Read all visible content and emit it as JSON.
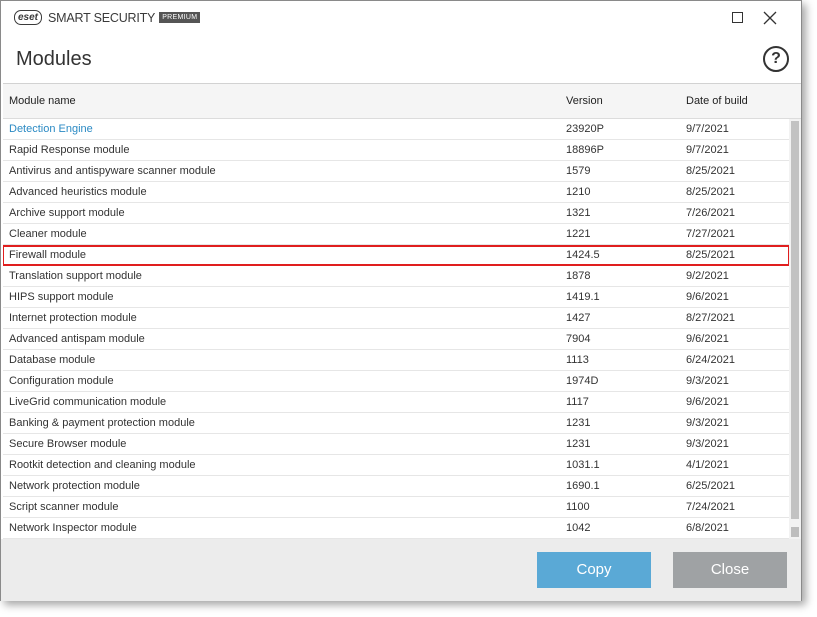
{
  "titlebar": {
    "logo": "eset",
    "product": "SMART SECURITY",
    "edition": "PREMIUM",
    "minimize_icon": "maximize-square-icon",
    "close_icon": "close-x-icon"
  },
  "page": {
    "title": "Modules",
    "help": "?"
  },
  "table": {
    "headers": {
      "name": "Module name",
      "version": "Version",
      "date": "Date of build"
    },
    "rows": [
      {
        "name": "Detection Engine",
        "version": "23920P",
        "date": "9/7/2021"
      },
      {
        "name": "Rapid Response module",
        "version": "18896P",
        "date": "9/7/2021"
      },
      {
        "name": "Antivirus and antispyware scanner module",
        "version": "1579",
        "date": "8/25/2021"
      },
      {
        "name": "Advanced heuristics module",
        "version": "1210",
        "date": "8/25/2021"
      },
      {
        "name": "Archive support module",
        "version": "1321",
        "date": "7/26/2021"
      },
      {
        "name": "Cleaner module",
        "version": "1221",
        "date": "7/27/2021"
      },
      {
        "name": "Firewall module",
        "version": "1424.5",
        "date": "8/25/2021"
      },
      {
        "name": "Translation support module",
        "version": "1878",
        "date": "9/2/2021"
      },
      {
        "name": "HIPS support module",
        "version": "1419.1",
        "date": "9/6/2021"
      },
      {
        "name": "Internet protection module",
        "version": "1427",
        "date": "8/27/2021"
      },
      {
        "name": "Advanced antispam module",
        "version": "7904",
        "date": "9/6/2021"
      },
      {
        "name": "Database module",
        "version": "1113",
        "date": "6/24/2021"
      },
      {
        "name": "Configuration module",
        "version": "1974D",
        "date": "9/3/2021"
      },
      {
        "name": "LiveGrid communication module",
        "version": "1117",
        "date": "9/6/2021"
      },
      {
        "name": "Banking & payment protection module",
        "version": "1231",
        "date": "9/3/2021"
      },
      {
        "name": "Secure Browser module",
        "version": "1231",
        "date": "9/3/2021"
      },
      {
        "name": "Rootkit detection and cleaning module",
        "version": "1031.1",
        "date": "4/1/2021"
      },
      {
        "name": "Network protection module",
        "version": "1690.1",
        "date": "6/25/2021"
      },
      {
        "name": "Script scanner module",
        "version": "1100",
        "date": "7/24/2021"
      },
      {
        "name": "Network Inspector module",
        "version": "1042",
        "date": "6/8/2021"
      }
    ]
  },
  "footer": {
    "copy_label": "Copy",
    "close_label": "Close"
  },
  "colors": {
    "link": "#2b8ac4",
    "highlight": "#e01e1e",
    "copy_button": "#5aa9d6",
    "close_button": "#9fa2a4"
  }
}
